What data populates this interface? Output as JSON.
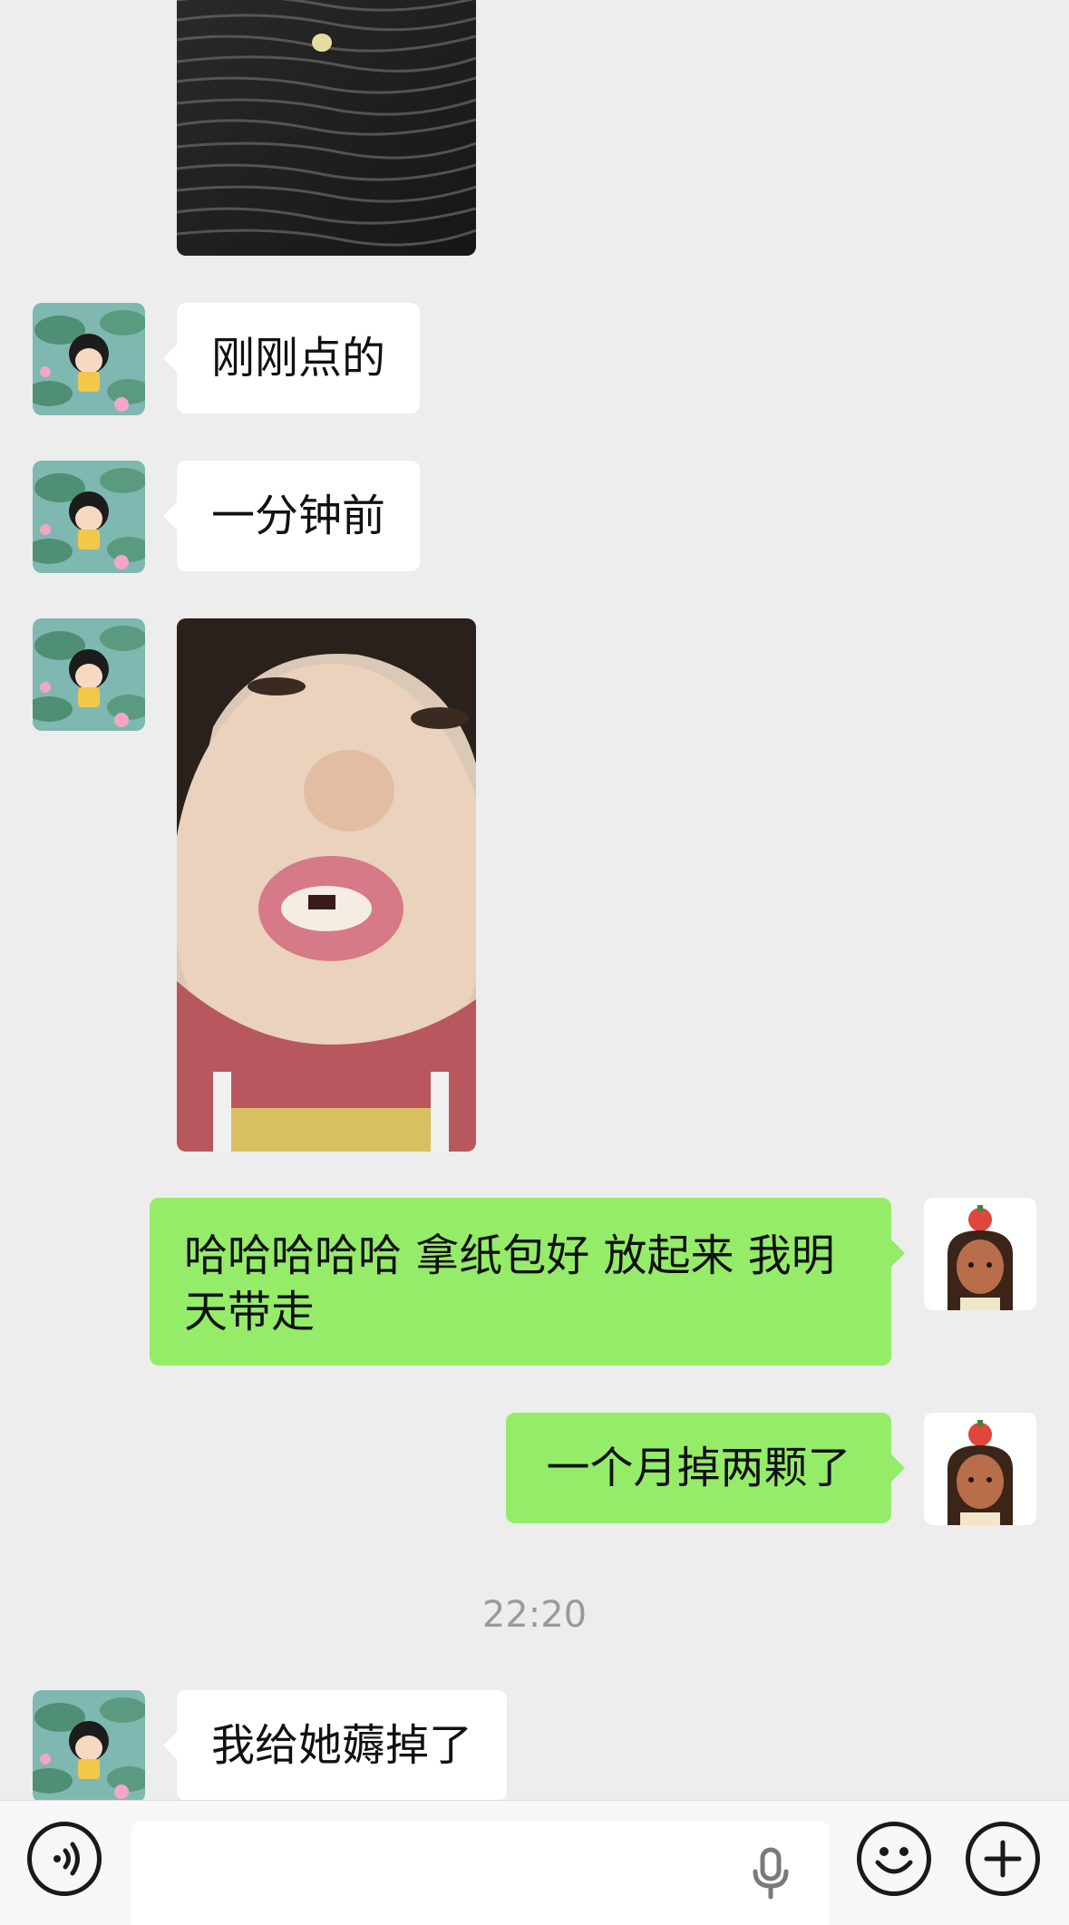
{
  "messages": [
    {
      "sender": "contact",
      "type": "image",
      "description_name": "black-textured-surface-photo"
    },
    {
      "sender": "contact",
      "type": "text",
      "text": "刚刚点的"
    },
    {
      "sender": "contact",
      "type": "text",
      "text": "一分钟前"
    },
    {
      "sender": "contact",
      "type": "image",
      "description_name": "child-missing-tooth-photo"
    },
    {
      "sender": "me",
      "type": "text",
      "text": "哈哈哈哈哈 拿纸包好 放起来 我明天带走"
    },
    {
      "sender": "me",
      "type": "text",
      "text": "一个月掉两颗了"
    },
    {
      "type": "timestamp",
      "text": "22:20"
    },
    {
      "sender": "contact",
      "type": "text",
      "text": "我给她薅掉了"
    }
  ],
  "input_bar": {
    "voice_icon": "voice-mode-icon",
    "mic_icon": "microphone-icon",
    "emoji_icon": "emoji-icon",
    "plus_icon": "plus-icon",
    "text_value": ""
  },
  "colors": {
    "background": "#ededed",
    "incoming_bubble": "#ffffff",
    "outgoing_bubble": "#95ec69",
    "timestamp": "#9a9a9a"
  }
}
